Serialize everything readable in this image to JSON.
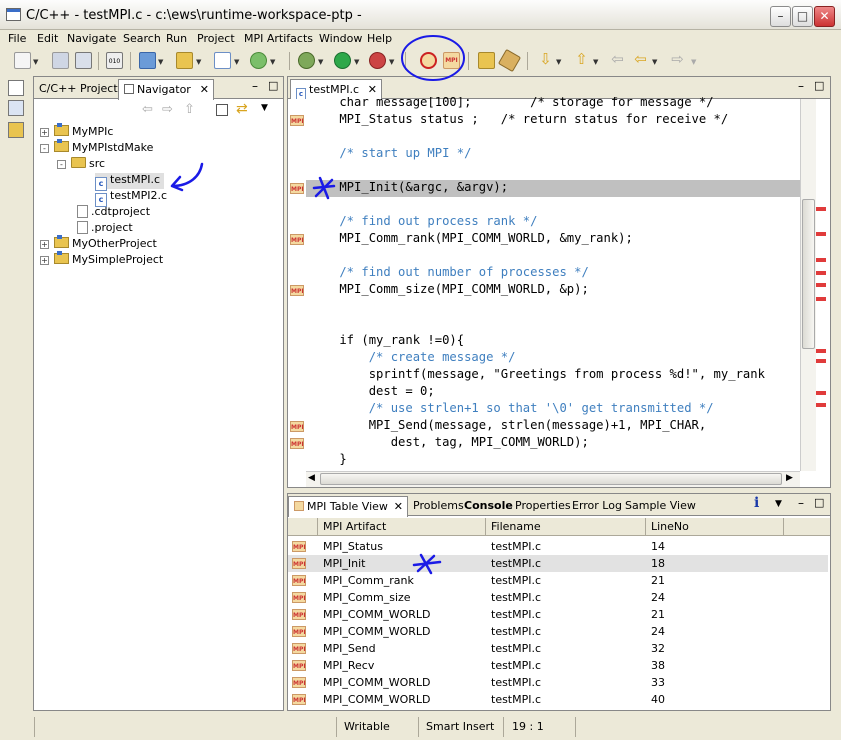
{
  "window": {
    "title": "C/C++ - testMPI.c - c:\\ews\\runtime-workspace-ptp -"
  },
  "menu": [
    "File",
    "Edit",
    "Navigate",
    "Search",
    "Run",
    "Project",
    "MPI Artifacts",
    "Window",
    "Help"
  ],
  "left_panel": {
    "tabs": [
      {
        "label": "C/C++ Projects"
      },
      {
        "label": "Navigator"
      }
    ],
    "tree": [
      {
        "label": "MyMPIc",
        "type": "project",
        "level": 0,
        "expander": "+"
      },
      {
        "label": "MyMPIstdMake",
        "type": "project",
        "level": 0,
        "expander": "-"
      },
      {
        "label": "src",
        "type": "folder",
        "level": 1,
        "expander": "-"
      },
      {
        "label": "testMPI.c",
        "type": "cfile",
        "level": 2,
        "selected": true
      },
      {
        "label": "testMPI2.c",
        "type": "cfile",
        "level": 2
      },
      {
        "label": ".cdtproject",
        "type": "file",
        "level": 1
      },
      {
        "label": ".project",
        "type": "file",
        "level": 1
      },
      {
        "label": "MyOtherProject",
        "type": "project",
        "level": 0,
        "expander": "+"
      },
      {
        "label": "MySimpleProject",
        "type": "project",
        "level": 0,
        "expander": "+"
      }
    ]
  },
  "editor": {
    "tab": "testMPI.c",
    "lines": [
      "    char message[100];        /* storage for message */",
      "    MPI_Status status ;   /* return status for receive */",
      "",
      "    /* start up MPI */",
      "",
      "    MPI_Init(&argc, &argv);",
      "",
      "    /* find out process rank */",
      "    MPI_Comm_rank(MPI_COMM_WORLD, &my_rank);",
      "",
      "    /* find out number of processes */",
      "    MPI_Comm_size(MPI_COMM_WORLD, &p);",
      "",
      "",
      "    if (my_rank !=0){",
      "        /* create message */",
      "        sprintf(message, \"Greetings from process %d!\", my_rank",
      "        dest = 0;",
      "        /* use strlen+1 so that '\\0' get transmitted */",
      "        MPI_Send(message, strlen(message)+1, MPI_CHAR,",
      "           dest, tag, MPI_COMM_WORLD);",
      "    }"
    ],
    "mpi_marker_label": "MPI"
  },
  "bottom_panel": {
    "tabs": [
      {
        "label": "MPI Table View"
      },
      {
        "label": "Problems"
      },
      {
        "label": "Console"
      },
      {
        "label": "Properties"
      },
      {
        "label": "Error Log"
      },
      {
        "label": "Sample View"
      }
    ],
    "columns": [
      "MPI Artifact",
      "Filename",
      "LineNo"
    ],
    "rows": [
      {
        "artifact": "MPI_Status",
        "filename": "testMPI.c",
        "line": "14"
      },
      {
        "artifact": "MPI_Init",
        "filename": "testMPI.c",
        "line": "18",
        "selected": true
      },
      {
        "artifact": "MPI_Comm_rank",
        "filename": "testMPI.c",
        "line": "21"
      },
      {
        "artifact": "MPI_Comm_size",
        "filename": "testMPI.c",
        "line": "24"
      },
      {
        "artifact": "MPI_COMM_WORLD",
        "filename": "testMPI.c",
        "line": "21"
      },
      {
        "artifact": "MPI_COMM_WORLD",
        "filename": "testMPI.c",
        "line": "24"
      },
      {
        "artifact": "MPI_Send",
        "filename": "testMPI.c",
        "line": "32"
      },
      {
        "artifact": "MPI_Recv",
        "filename": "testMPI.c",
        "line": "38"
      },
      {
        "artifact": "MPI_COMM_WORLD",
        "filename": "testMPI.c",
        "line": "33"
      },
      {
        "artifact": "MPI_COMM_WORLD",
        "filename": "testMPI.c",
        "line": "40"
      }
    ]
  },
  "status": {
    "writable": "Writable",
    "insert_mode": "Smart Insert",
    "position": "19 : 1"
  },
  "colors": {
    "annotation_ink": "#1a1ae6",
    "selection": "#c0c0c0",
    "comment": "#3f7fbf",
    "keyword": "#7f0055",
    "string": "#2a00ff"
  }
}
